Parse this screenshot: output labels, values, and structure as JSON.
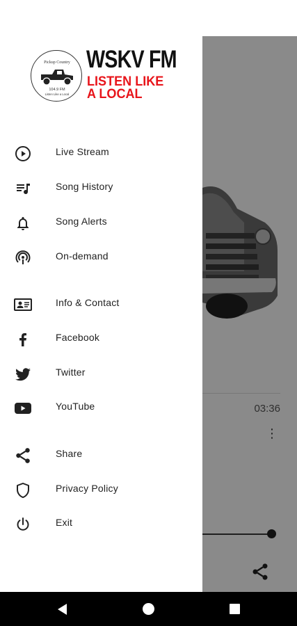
{
  "background_player": {
    "duration": "03:36",
    "more_icon": "more-vert-icon",
    "share_icon": "share-icon",
    "colors": {
      "scrim": "#8a8a8a"
    }
  },
  "drawer": {
    "logo": {
      "station": "WSKV FM",
      "tagline_line1": "LISTEN LIKE",
      "tagline_line2": "A LOCAL",
      "badge_top": "Pickup Country",
      "badge_freq": "104.9 FM",
      "badge_bottom": "Listen Like a Local",
      "colors": {
        "tagline": "#e8141a"
      }
    },
    "items": [
      {
        "label": "Live Stream",
        "icon": "play-circle-icon"
      },
      {
        "label": "Song History",
        "icon": "queue-music-icon"
      },
      {
        "label": "Song Alerts",
        "icon": "bell-icon"
      },
      {
        "label": "On-demand",
        "icon": "podcast-icon"
      },
      {
        "label": "Info & Contact",
        "icon": "contact-card-icon"
      },
      {
        "label": "Facebook",
        "icon": "facebook-icon"
      },
      {
        "label": "Twitter",
        "icon": "twitter-icon"
      },
      {
        "label": "YouTube",
        "icon": "youtube-icon"
      },
      {
        "label": "Share",
        "icon": "share-icon"
      },
      {
        "label": "Privacy Policy",
        "icon": "shield-icon"
      },
      {
        "label": "Exit",
        "icon": "power-icon"
      }
    ]
  },
  "navbar": {
    "back": "back-icon",
    "home": "home-icon",
    "recents": "recents-icon"
  }
}
